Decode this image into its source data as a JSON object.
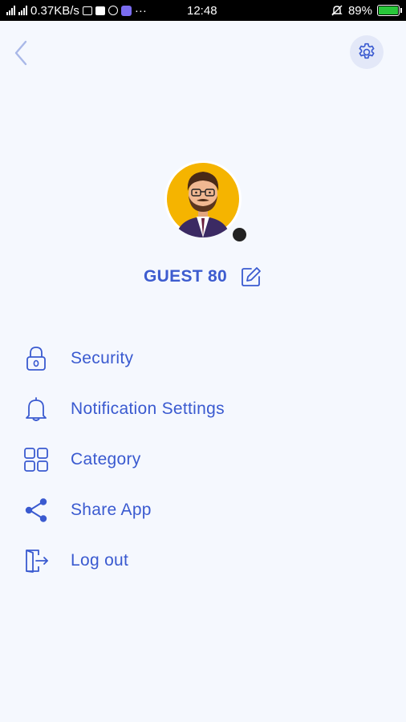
{
  "status_bar": {
    "speed": "0.37KB/s",
    "time": "12:48",
    "dots": "···",
    "battery": "89%"
  },
  "nav": {
    "back_icon": "chevron-left-icon",
    "settings_icon": "gear-icon"
  },
  "profile": {
    "name": "GUEST 80",
    "online_status_color": "#222222"
  },
  "menu": {
    "items": [
      {
        "label": "Security",
        "icon": "lock-icon"
      },
      {
        "label": "Notification Settings",
        "icon": "bell-icon"
      },
      {
        "label": "Category",
        "icon": "grid-icon"
      },
      {
        "label": "Share App",
        "icon": "share-icon"
      },
      {
        "label": "Log out",
        "icon": "logout-icon"
      }
    ]
  },
  "colors": {
    "accent": "#3a5ad0",
    "background": "#f5f8fe",
    "avatar_ring": "#f5b400"
  }
}
